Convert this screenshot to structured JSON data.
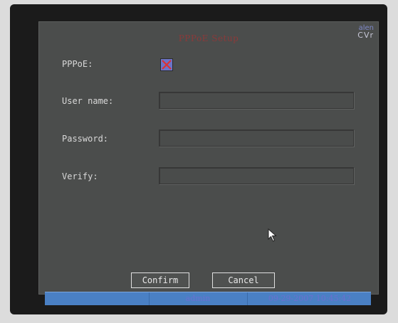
{
  "window": {
    "title": "PPPoE Setup",
    "logo_line1": "alen",
    "logo_line2": "CVr"
  },
  "form": {
    "pppoe_label": "PPPoE:",
    "pppoe_checked": true,
    "username_label": "User name:",
    "username_value": "",
    "password_label": "Password:",
    "password_value": "",
    "verify_label": "Verify:",
    "verify_value": ""
  },
  "buttons": {
    "confirm_label": "Confirm",
    "cancel_label": "Cancel"
  },
  "status_bar": {
    "user": "admin",
    "datetime": "09-29-2007 10:45:42"
  },
  "colors": {
    "panel_bg": "#4b4d4c",
    "title_color": "#8a3a3a",
    "checkbox_fill": "#6c74c8",
    "checkbox_mark": "#e03030",
    "status_bar_bg": "#4a80c4"
  },
  "icons": {
    "checkbox_mark": "x-mark-icon",
    "cursor": "mouse-pointer-icon",
    "logo": "brand-logo"
  }
}
